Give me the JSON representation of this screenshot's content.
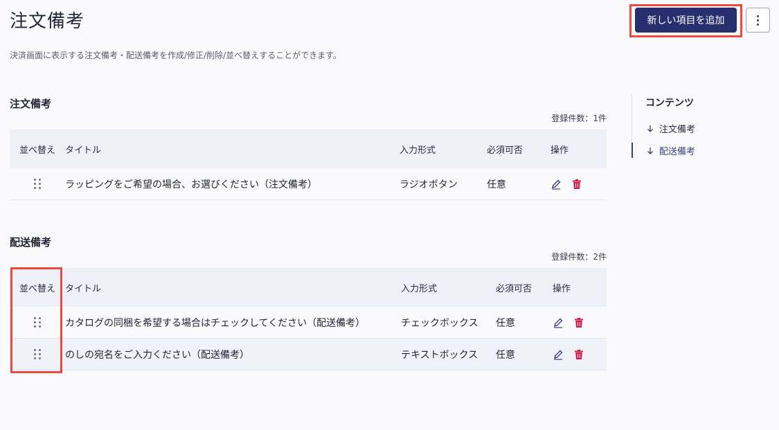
{
  "header": {
    "title": "注文備考",
    "description": "決済画面に表示する注文備考・配送備考を作成/修正/削除/並べ替えすることができます。",
    "add_button": "新しい項目を追加",
    "more_icon": "kebab-menu-icon"
  },
  "columns": {
    "sort": "並べ替え",
    "title": "タイトル",
    "input_type": "入力形式",
    "required": "必須可否",
    "actions": "操作"
  },
  "order_notes": {
    "heading": "注文備考",
    "count": "登録件数：1件",
    "rows": [
      {
        "title": "ラッピングをご希望の場合、お選びください（注文備考）",
        "input_type": "ラジオボタン",
        "required": "任意"
      }
    ]
  },
  "shipping_notes": {
    "heading": "配送備考",
    "count": "登録件数：2件",
    "rows": [
      {
        "title": "カタログの同梱を希望する場合はチェックしてください（配送備考）",
        "input_type": "チェックボックス",
        "required": "任意"
      },
      {
        "title": "のしの宛名をご入力ください（配送備考）",
        "input_type": "テキストボックス",
        "required": "任意"
      }
    ]
  },
  "toc": {
    "title": "コンテンツ",
    "items": [
      {
        "label": "注文備考"
      },
      {
        "label": "配送備考"
      }
    ]
  },
  "colors": {
    "primary": "#282f6e",
    "danger": "#d81b4a",
    "highlight": "#ea4a3e"
  }
}
